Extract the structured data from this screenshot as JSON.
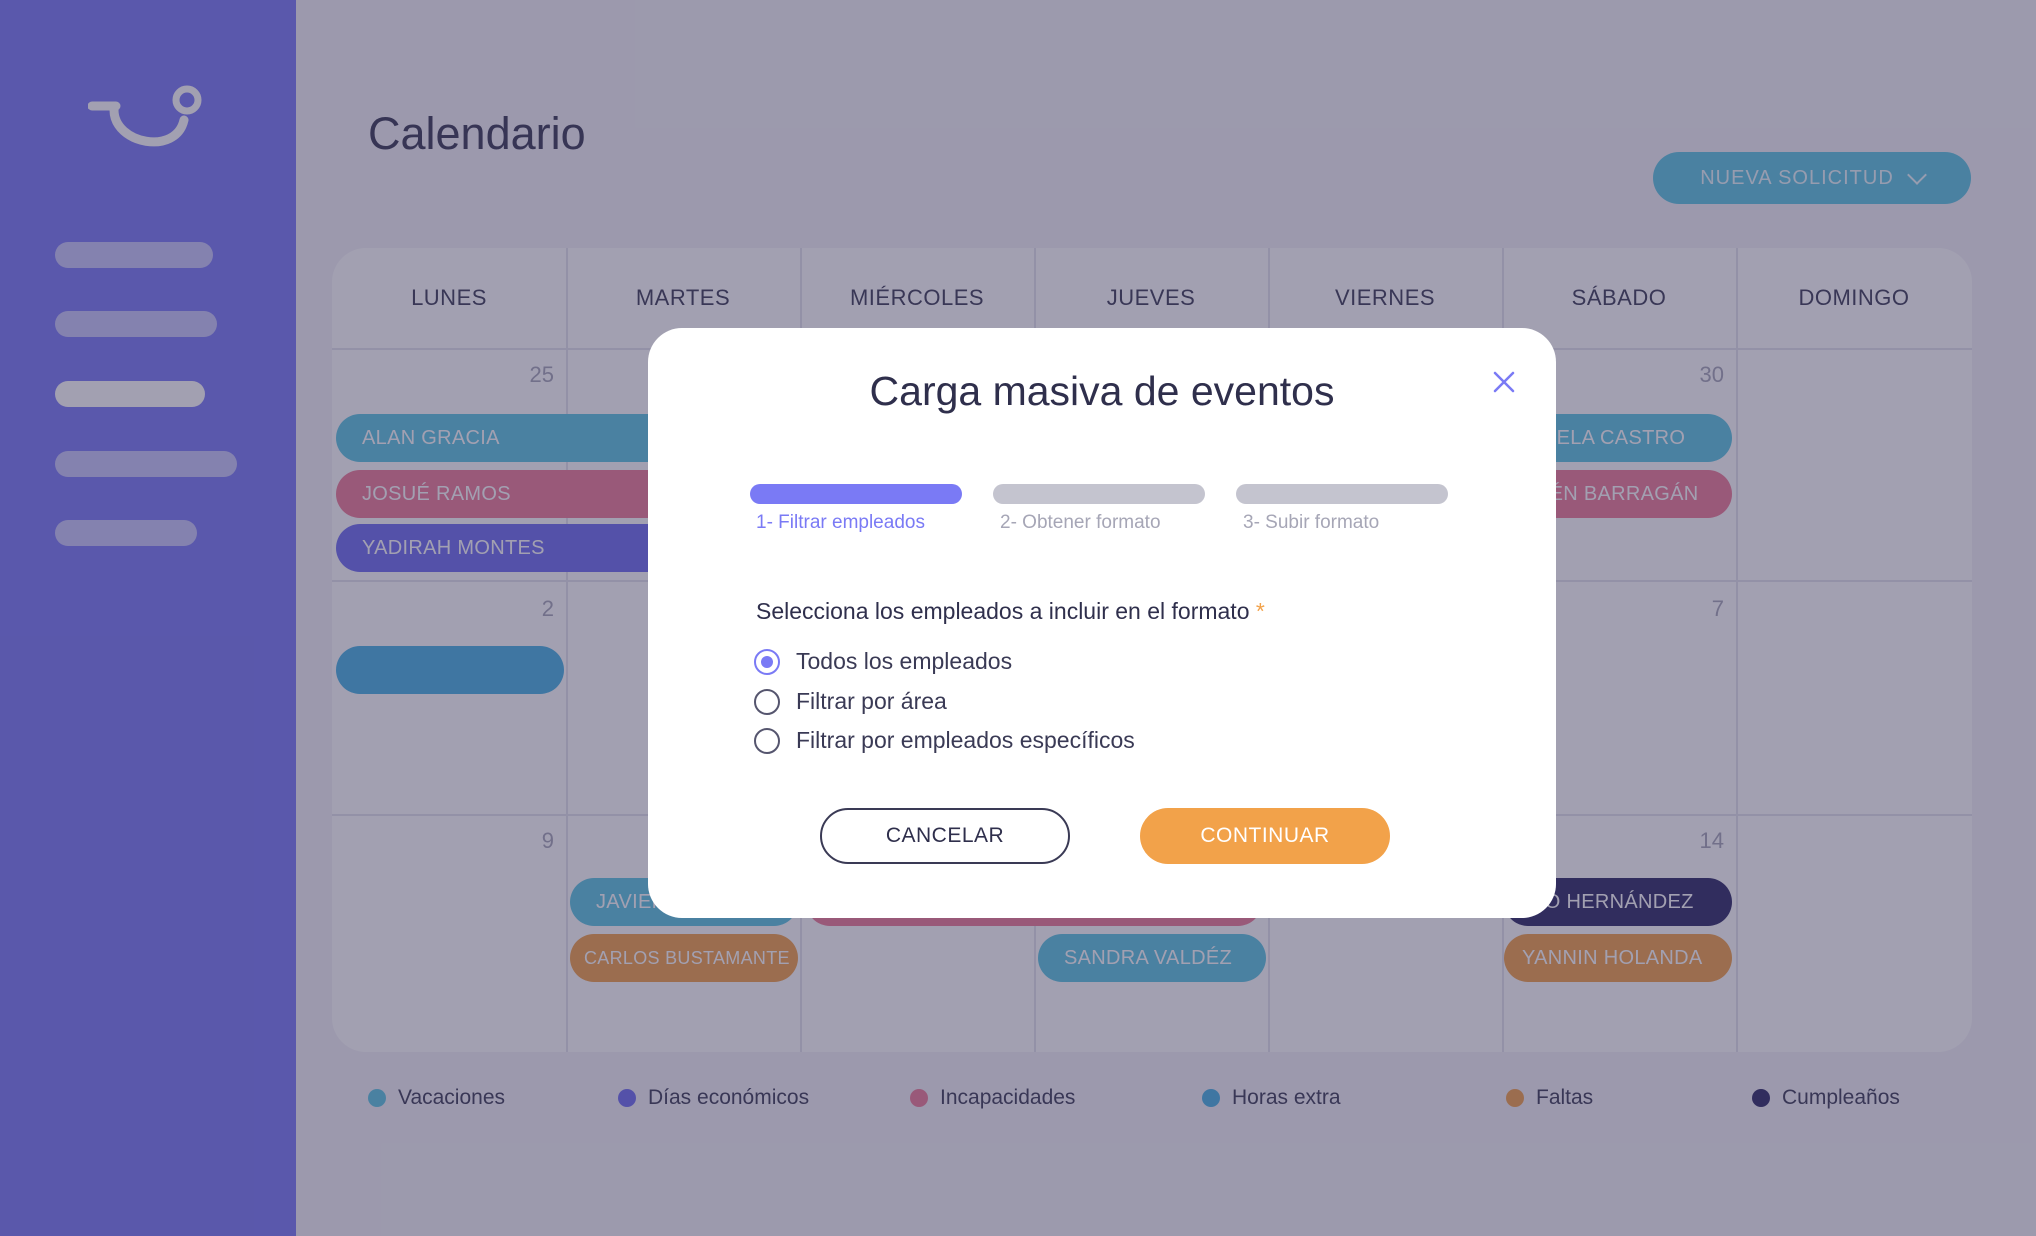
{
  "app": {
    "page_title": "Calendario",
    "new_request_label": "NUEVA SOLICITUD"
  },
  "calendar": {
    "days": [
      "LUNES",
      "MARTES",
      "MIÉRCOLES",
      "JUEVES",
      "VIERNES",
      "SÁBADO",
      "DOMINGO"
    ],
    "date_numbers": [
      "25",
      "30",
      "2",
      "7",
      "9",
      "14"
    ],
    "events": [
      {
        "label": "ALAN GRACIA",
        "type": "vacaciones"
      },
      {
        "label": "JOSUÉ RAMOS",
        "type": "incapacidades"
      },
      {
        "label": "YADIRAH MONTES",
        "type": "dias_economicos"
      },
      {
        "label": "",
        "type": "horas_extra"
      },
      {
        "label": "NIELA CASTRO",
        "type": "vacaciones"
      },
      {
        "label": "BÉN BARRAGÁN",
        "type": "incapacidades"
      },
      {
        "label": "JAVIER",
        "type": "vacaciones"
      },
      {
        "label": "CARLOS BUSTAMANTE",
        "type": "faltas"
      },
      {
        "label": "",
        "type": "incapacidades"
      },
      {
        "label": "SANDRA VALDÉZ",
        "type": "vacaciones"
      },
      {
        "label": "RO HERNÁNDEZ",
        "type": "cumpleanos"
      },
      {
        "label": "YANNIN HOLANDA",
        "type": "faltas"
      }
    ]
  },
  "legend": [
    {
      "label": "Vacaciones",
      "color": "#5dc6e2"
    },
    {
      "label": "Días económicos",
      "color": "#6f6ef0"
    },
    {
      "label": "Incapacidades",
      "color": "#ef7d98"
    },
    {
      "label": "Horas extra",
      "color": "#48b2e4"
    },
    {
      "label": "Faltas",
      "color": "#f2a24a"
    },
    {
      "label": "Cumpleaños",
      "color": "#2f2b66"
    }
  ],
  "colors": {
    "sidebar": "#7a7af5",
    "accent": "#7a7af5",
    "primary_button": "#f2a24a",
    "overlay": "rgba(52,48,84,0.46)"
  },
  "icons": {
    "logo": "smile-hook-logo",
    "close": "close-icon",
    "dropdown": "chevron-down-icon"
  },
  "modal": {
    "title": "Carga masiva de eventos",
    "steps": [
      {
        "label": "1- Filtrar empleados",
        "active": true
      },
      {
        "label": "2- Obtener formato",
        "active": false
      },
      {
        "label": "3- Subir formato",
        "active": false
      }
    ],
    "question": "Selecciona los empleados a incluir en el formato",
    "required_mark": "*",
    "options": [
      {
        "label": "Todos los empleados",
        "checked": true
      },
      {
        "label": "Filtrar por área",
        "checked": false
      },
      {
        "label": "Filtrar por empleados específicos",
        "checked": false
      }
    ],
    "cancel_label": "CANCELAR",
    "continue_label": "CONTINUAR"
  }
}
